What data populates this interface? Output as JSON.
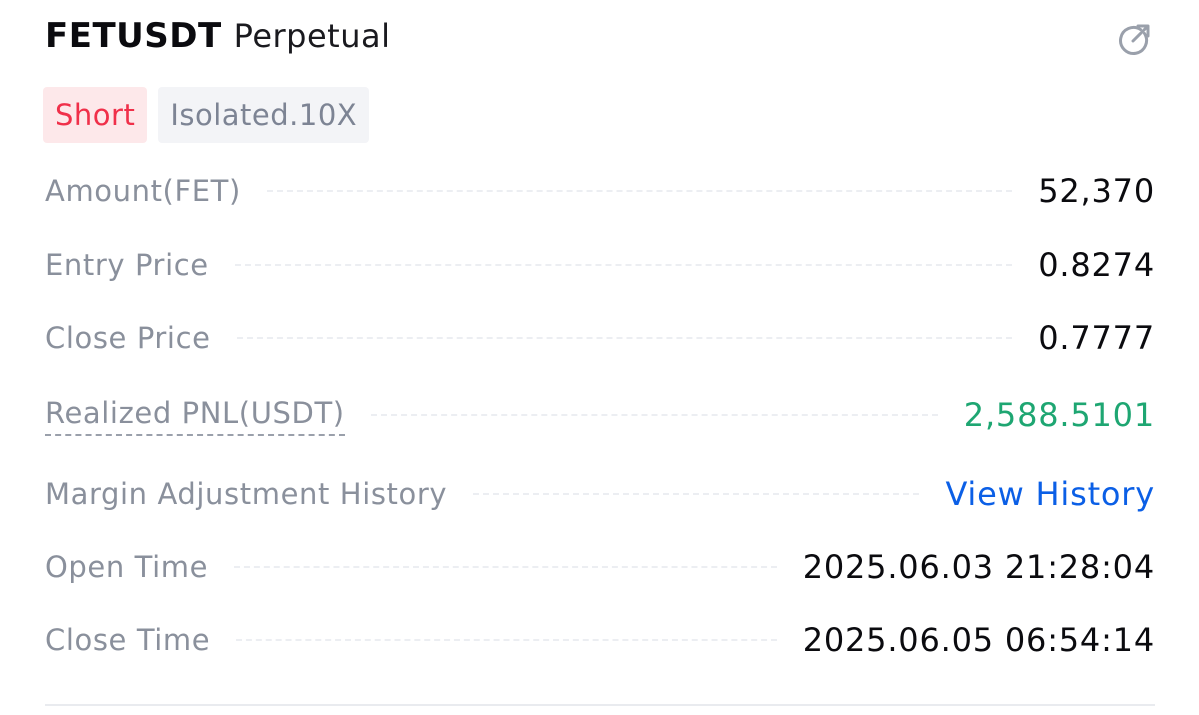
{
  "header": {
    "symbol": "FETUSDT",
    "contract_type": "Perpetual",
    "share_icon": "share-external-icon"
  },
  "tags": {
    "side": "Short",
    "margin_mode": "Isolated.10X"
  },
  "details": {
    "amount": {
      "label": "Amount(FET)",
      "value": "52,370"
    },
    "entry_price": {
      "label": "Entry Price",
      "value": "0.8274"
    },
    "close_price": {
      "label": "Close Price",
      "value": "0.7777"
    },
    "realized_pnl": {
      "label": "Realized PNL(USDT)",
      "value": "2,588.5101"
    },
    "margin_history": {
      "label": "Margin Adjustment History",
      "value": "View History"
    },
    "open_time": {
      "label": "Open Time",
      "value": "2025.06.03 21:28:04"
    },
    "close_time": {
      "label": "Close Time",
      "value": "2025.06.05 06:54:14"
    }
  },
  "colors": {
    "short_text": "#f0304a",
    "short_bg": "#fde8ea",
    "tag_gray_text": "#7d8494",
    "tag_gray_bg": "#f3f4f7",
    "label_gray": "#8a909c",
    "positive_green": "#1ea672",
    "link_blue": "#0b5fe6",
    "icon_gray": "#9aa0ab"
  }
}
